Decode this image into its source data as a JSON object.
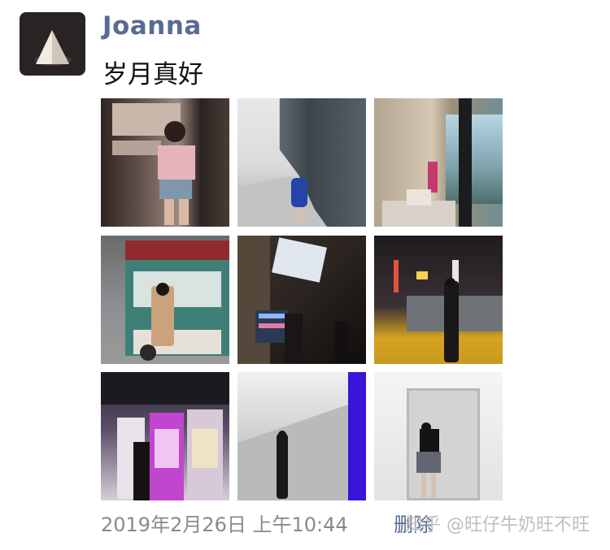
{
  "post": {
    "username": "Joanna",
    "text": "岁月真好",
    "timestamp": "2019年2月26日 上午10:44",
    "delete_label": "删除",
    "avatar_icon": "triangle-logo-icon"
  },
  "watermark": "知乎 @旺仔牛奶旺不旺",
  "photos": [
    {
      "name": "photo-girl-pink-top-wall",
      "bg": "#5b4a45"
    },
    {
      "name": "photo-walkway-glass-building",
      "bg": "#b9bcc0"
    },
    {
      "name": "photo-room-window-view",
      "bg": "#c7b9a5"
    },
    {
      "name": "photo-green-food-truck",
      "bg": "#6f8f86"
    },
    {
      "name": "photo-night-building-screen",
      "bg": "#2b2420"
    },
    {
      "name": "photo-night-street-lights",
      "bg": "#1d1a1c"
    },
    {
      "name": "photo-claw-machines",
      "bg": "#3a2e40"
    },
    {
      "name": "photo-white-stairway",
      "bg": "#cfcfcf"
    },
    {
      "name": "photo-white-room-doorway",
      "bg": "#ebebeb"
    }
  ]
}
